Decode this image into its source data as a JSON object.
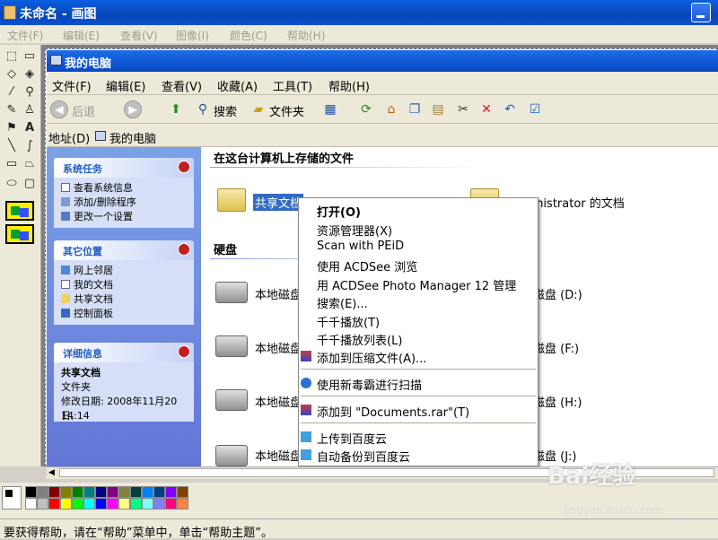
{
  "paint": {
    "title": "未命名 - 画图",
    "menu": [
      "文件(F)",
      "编辑(E)",
      "查看(V)",
      "图像(I)",
      "颜色(C)",
      "帮助(H)"
    ],
    "status": "要获得帮助，请在“帮助”菜单中，单击“帮助主题”。"
  },
  "explorer": {
    "title": "我的电脑",
    "menu": [
      "文件(F)",
      "编辑(E)",
      "查看(V)",
      "收藏(A)",
      "工具(T)",
      "帮助(H)"
    ],
    "toolbar": {
      "back": "后退",
      "search": "搜索",
      "folders": "文件夹"
    },
    "address_label": "地址(D)",
    "address_value": "我的电脑",
    "sidebar": {
      "tasks": {
        "title": "系统任务",
        "items": [
          "查看系统信息",
          "添加/删除程序",
          "更改一个设置"
        ]
      },
      "places": {
        "title": "其它位置",
        "items": [
          "网上邻居",
          "我的文档",
          "共享文档",
          "控制面板"
        ]
      },
      "details": {
        "title": "详细信息",
        "name": "共享文档",
        "type": "文件夹",
        "modified": "修改日期: 2008年11月20日,",
        "time": "14:14"
      }
    },
    "sections": {
      "files": "在这台计算机上存储的文件",
      "disks": "硬盘"
    },
    "files": {
      "shared": "共享文档",
      "admin": "Administrator 的文档"
    },
    "drives_left": [
      "本地磁盘",
      "本地磁盘",
      "本地磁盘",
      "本地磁盘"
    ],
    "drives_right": [
      "磁盘 (D:)",
      "磁盘 (F:)",
      "磁盘 (H:)",
      "磁盘 (J:)"
    ]
  },
  "context_menu": [
    "打开(O)",
    "资源管理器(X)",
    "Scan with PEiD",
    "使用 ACDSee 浏览",
    "用 ACDSee Photo Manager 12 管理",
    "搜索(E)...",
    "千千播放(T)",
    "千千播放列表(L)",
    "添加到压缩文件(A)...",
    "使用新毒霸进行扫描",
    "添加到 \"Documents.rar\"(T)",
    "上传到百度云",
    "自动备份到百度云"
  ],
  "watermark": {
    "brand": "Bai经验",
    "url": "jingyan.baidu.com"
  },
  "colors": {
    "titlebar": "#0747b8",
    "sidebar": "#6375d6",
    "selection": "#316ac5",
    "palette": [
      "#000000",
      "#808080",
      "#800000",
      "#808000",
      "#008000",
      "#008080",
      "#000080",
      "#800080",
      "#808040",
      "#004040",
      "#0080ff",
      "#004080",
      "#8000ff",
      "#804000",
      "#ffffff",
      "#c0c0c0",
      "#ff0000",
      "#ffff00",
      "#00ff00",
      "#00ffff",
      "#0000ff",
      "#ff00ff",
      "#ffff80",
      "#00ff80",
      "#80ffff",
      "#8080ff",
      "#ff0080",
      "#ff8040"
    ]
  }
}
